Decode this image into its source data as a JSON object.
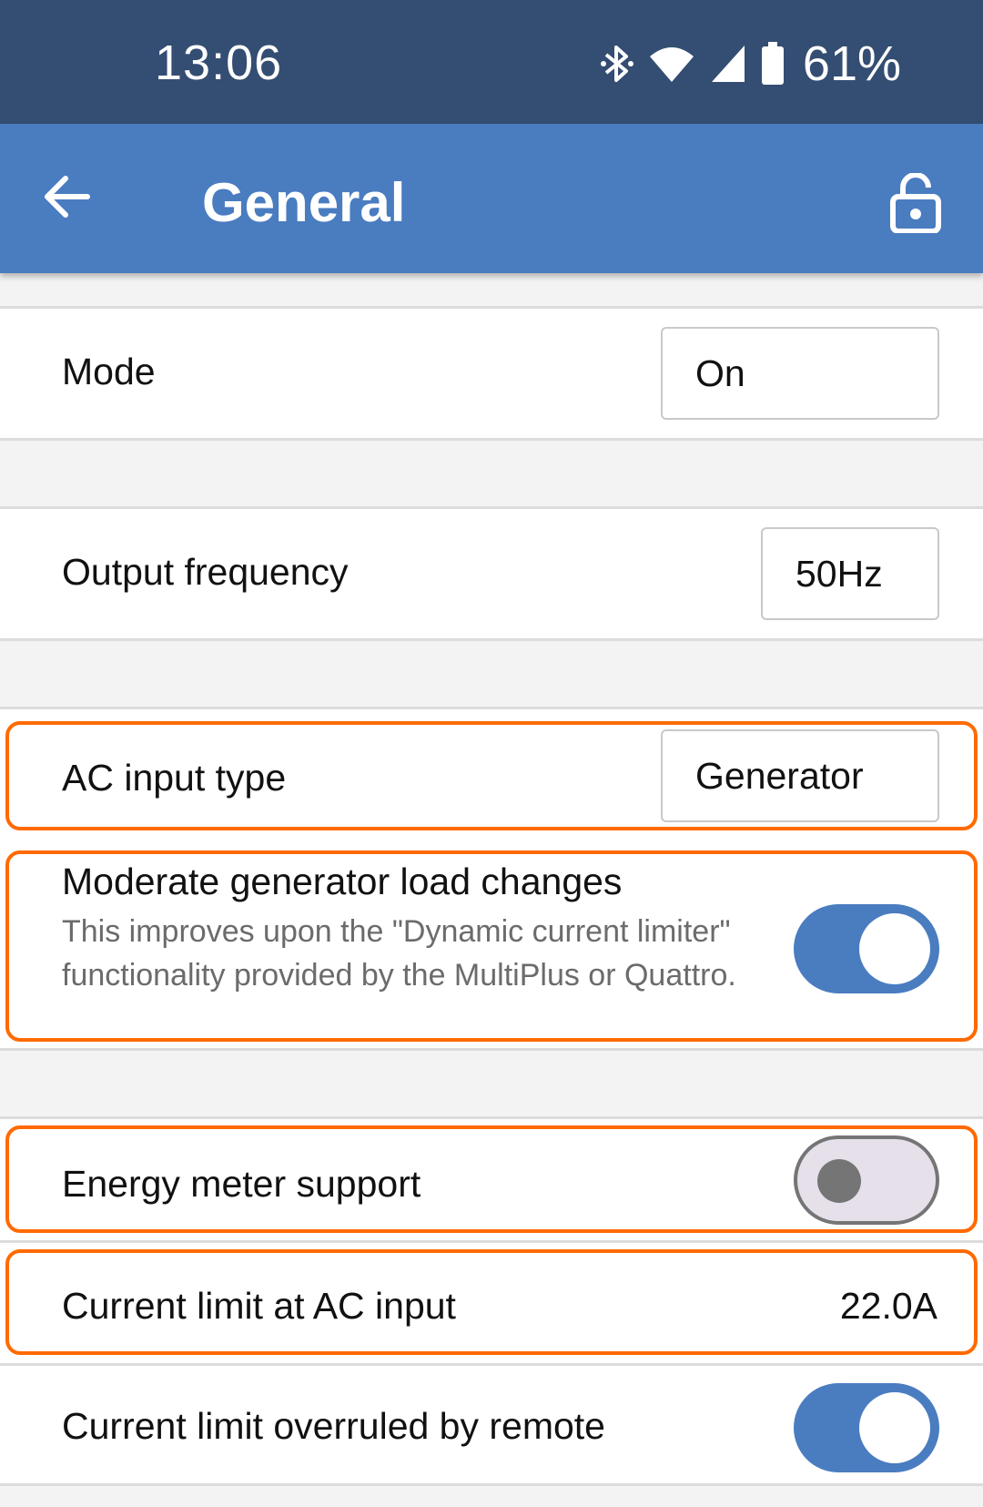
{
  "status_bar": {
    "time": "13:06",
    "icons": [
      "bluetooth-icon",
      "wifi-icon",
      "signal-icon",
      "battery-icon"
    ],
    "battery_percent": "61%"
  },
  "app_bar": {
    "title": "General",
    "back_icon": "arrow-left-icon",
    "lock_icon": "lock-open-icon"
  },
  "settings": {
    "mode": {
      "label": "Mode",
      "value": "On"
    },
    "output_frequency": {
      "label": "Output frequency",
      "value": "50Hz"
    },
    "ac_input_type": {
      "label": "AC input type",
      "value": "Generator"
    },
    "moderate_generator": {
      "label": "Moderate generator load changes",
      "description": "This improves upon the \"Dynamic current limiter\" functionality provided by the MultiPlus or Quattro.",
      "enabled": true
    },
    "energy_meter_support": {
      "label": "Energy meter support",
      "enabled": false
    },
    "current_limit": {
      "label": "Current limit at AC input",
      "value": "22.0A"
    },
    "current_limit_overruled": {
      "label": "Current limit overruled by remote",
      "enabled": true
    }
  },
  "colors": {
    "status_bar_bg": "#344d72",
    "app_bar_bg": "#4a7cc0",
    "highlight": "#ff6a00",
    "toggle_on": "#4a7cc0"
  }
}
